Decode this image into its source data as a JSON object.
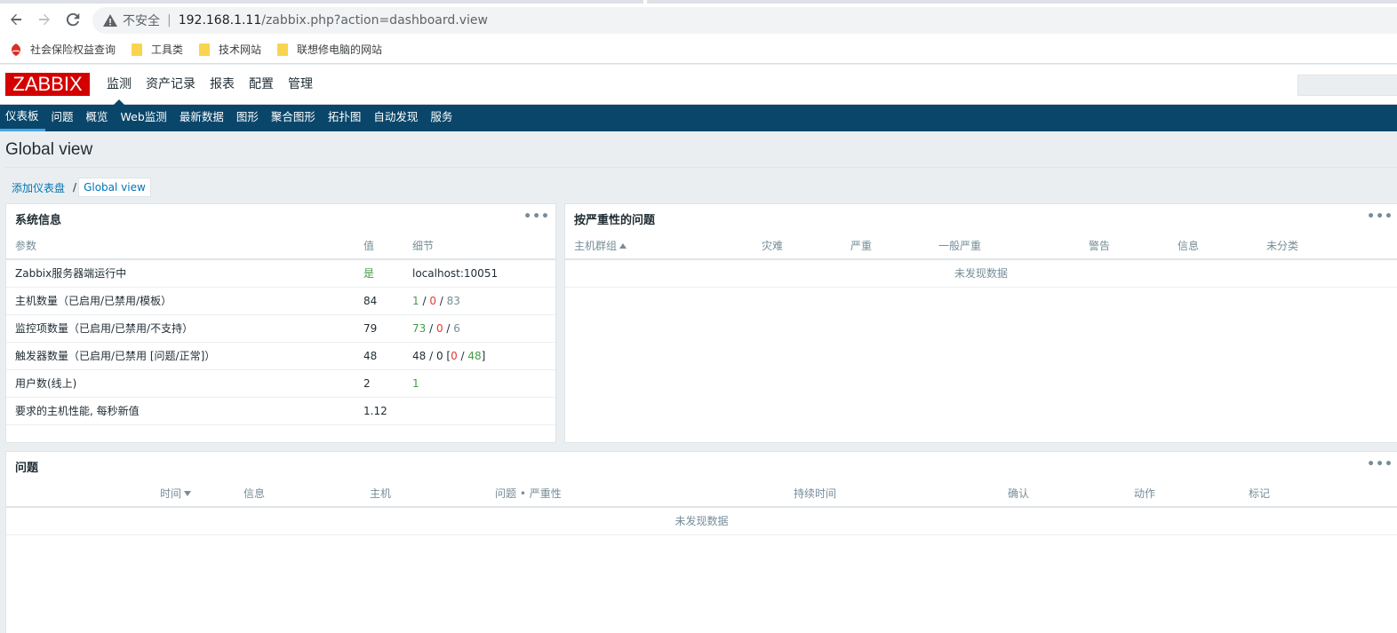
{
  "browser": {
    "insecure_label": "不安全",
    "url_host": "192.168.1.11",
    "url_path": "/zabbix.php?action=dashboard.view",
    "bookmarks": [
      {
        "label": "社会保险权益查询",
        "icon": "shield-logo-icon"
      },
      {
        "label": "工具类",
        "icon": "folder-icon"
      },
      {
        "label": "技术网站",
        "icon": "folder-icon"
      },
      {
        "label": "联想修电脑的网站",
        "icon": "folder-icon"
      }
    ]
  },
  "header": {
    "logo": "ZABBIX",
    "menu": [
      "监测",
      "资产记录",
      "报表",
      "配置",
      "管理"
    ],
    "active_menu": 0
  },
  "submenu": {
    "items": [
      "仪表板",
      "问题",
      "概览",
      "Web监测",
      "最新数据",
      "图形",
      "聚合图形",
      "拓扑图",
      "自动发现",
      "服务"
    ],
    "active": 0
  },
  "page": {
    "title": "Global view",
    "breadcrumb": {
      "parent": "添加仪表盘",
      "separator": "/",
      "current": "Global view"
    }
  },
  "system_info": {
    "title": "系统信息",
    "columns": [
      "参数",
      "值",
      "细节"
    ],
    "rows": [
      {
        "param": "Zabbix服务器端运行中",
        "value": "是",
        "detail": "localhost:10051"
      },
      {
        "param": "主机数量（已启用/已禁用/模板）",
        "value": "84",
        "d1": "1",
        "s1": " / ",
        "d2": "0",
        "s2": " / ",
        "d3": "83"
      },
      {
        "param": "监控项数量（已启用/已禁用/不支持）",
        "value": "79",
        "d1": "73",
        "s1": " / ",
        "d2": "0",
        "s2": " / ",
        "d3": "6"
      },
      {
        "param": "触发器数量（已启用/已禁用 [问题/正常]）",
        "value": "48",
        "d_prefix": "48 / 0 [",
        "d1": "0",
        "s1": " / ",
        "d2": "48",
        "d_suffix": "]"
      },
      {
        "param": "用户数(线上)",
        "value": "2",
        "detail": "1"
      },
      {
        "param": "要求的主机性能, 每秒新值",
        "value": "1.12",
        "detail": ""
      }
    ]
  },
  "problems_by_severity": {
    "title": "按严重性的问题",
    "columns": [
      "主机群组",
      "灾难",
      "严重",
      "一般严重",
      "警告",
      "信息",
      "未分类"
    ],
    "empty": "未发现数据"
  },
  "problems": {
    "title": "问题",
    "columns": [
      "时间",
      "信息",
      "主机",
      "问题 • 严重性",
      "持续时间",
      "确认",
      "动作",
      "标记"
    ],
    "empty": "未发现数据"
  },
  "colors": {
    "logo_red": "#d40000",
    "nav_blue": "#0a466a",
    "link_blue": "#0275b8",
    "ok_green": "#429e47",
    "problem_red": "#e33734"
  }
}
